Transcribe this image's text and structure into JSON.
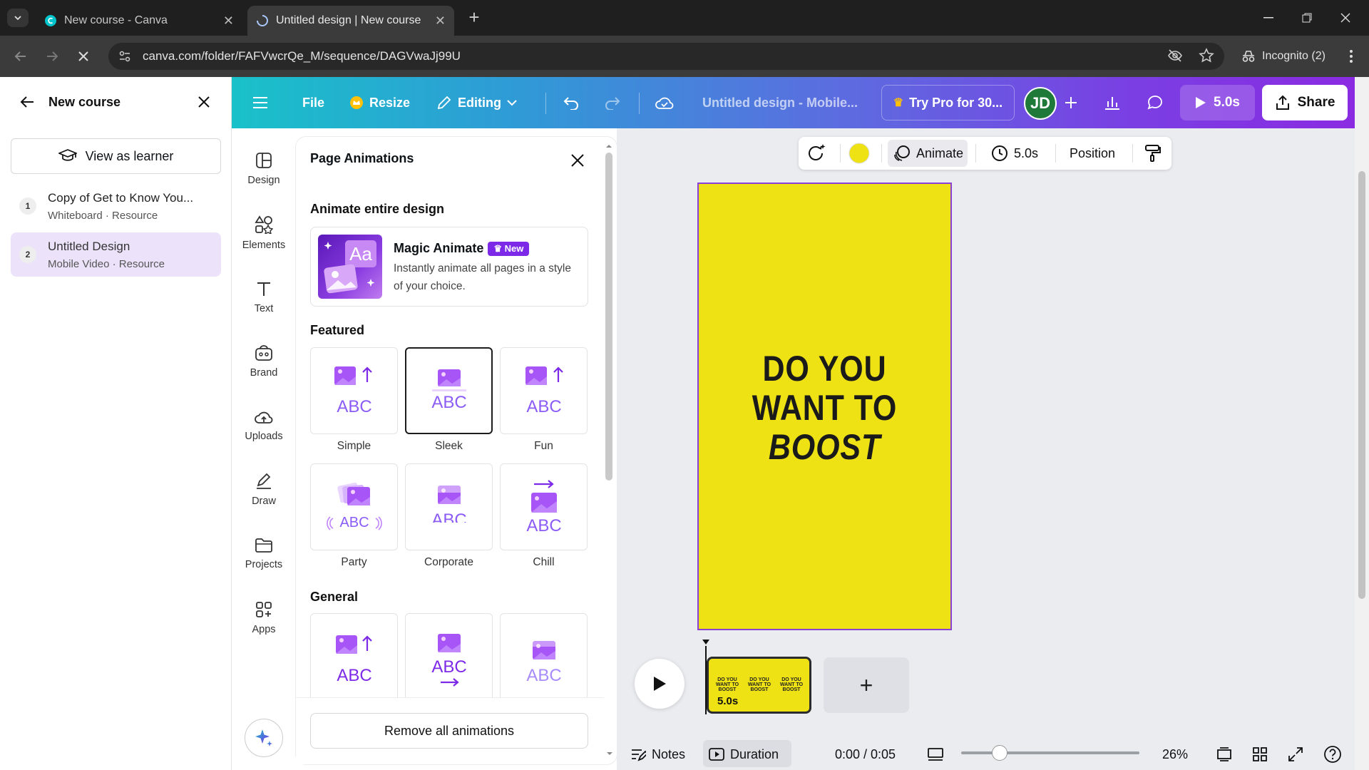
{
  "browser": {
    "tabs": [
      {
        "title": "New course - Canva",
        "active": false
      },
      {
        "title": "Untitled design | New course",
        "active": true
      }
    ],
    "url": "canva.com/folder/FAFVwcrQe_M/sequence/DAGVwaJj99U",
    "incognito_label": "Incognito (2)"
  },
  "course": {
    "title": "New course",
    "view_as_learner": "View as learner",
    "lessons": [
      {
        "num": "1",
        "title": "Copy of Get to Know You...",
        "subtitle": "Whiteboard · Resource",
        "active": false
      },
      {
        "num": "2",
        "title": "Untitled Design",
        "subtitle": "Mobile Video · Resource",
        "active": true
      }
    ]
  },
  "header": {
    "file": "File",
    "resize": "Resize",
    "editing": "Editing",
    "doc_title": "Untitled design - Mobile...",
    "try_pro": "Try Pro for 30...",
    "avatar_initials": "JD",
    "play_duration": "5.0s",
    "share": "Share"
  },
  "rail": [
    {
      "label": "Design",
      "icon": "layout-icon"
    },
    {
      "label": "Elements",
      "icon": "shapes-icon"
    },
    {
      "label": "Text",
      "icon": "text-icon"
    },
    {
      "label": "Brand",
      "icon": "brand-icon"
    },
    {
      "label": "Uploads",
      "icon": "cloud-upload-icon"
    },
    {
      "label": "Draw",
      "icon": "pen-icon"
    },
    {
      "label": "Projects",
      "icon": "folder-icon"
    },
    {
      "label": "Apps",
      "icon": "apps-icon"
    }
  ],
  "panel": {
    "title": "Page Animations",
    "entire_design": "Animate entire design",
    "magic": {
      "name": "Magic Animate",
      "badge": "New",
      "thumb_text": "Aa",
      "description": "Instantly animate all pages in a style of your choice."
    },
    "featured_title": "Featured",
    "featured": [
      {
        "label": "Simple",
        "selected": false
      },
      {
        "label": "Sleek",
        "selected": true
      },
      {
        "label": "Fun",
        "selected": false
      },
      {
        "label": "Party",
        "selected": false
      },
      {
        "label": "Corporate",
        "selected": false
      },
      {
        "label": "Chill",
        "selected": false
      }
    ],
    "general_title": "General",
    "remove_all": "Remove all animations"
  },
  "tile_text": {
    "abc": "ABC"
  },
  "context_bar": {
    "animate": "Animate",
    "duration": "5.0s",
    "position": "Position",
    "color": "#eee214"
  },
  "canvas": {
    "line1": "DO YOU",
    "line2": "WANT TO",
    "line3": "BOOST",
    "background": "#eee214"
  },
  "timeline": {
    "page_duration": "5.0s",
    "mini_text": "DO YOU WANT TO BOOST"
  },
  "footer": {
    "notes": "Notes",
    "duration": "Duration",
    "time": "0:00 / 0:05",
    "zoom": "26%",
    "zoom_level": 0.26
  }
}
